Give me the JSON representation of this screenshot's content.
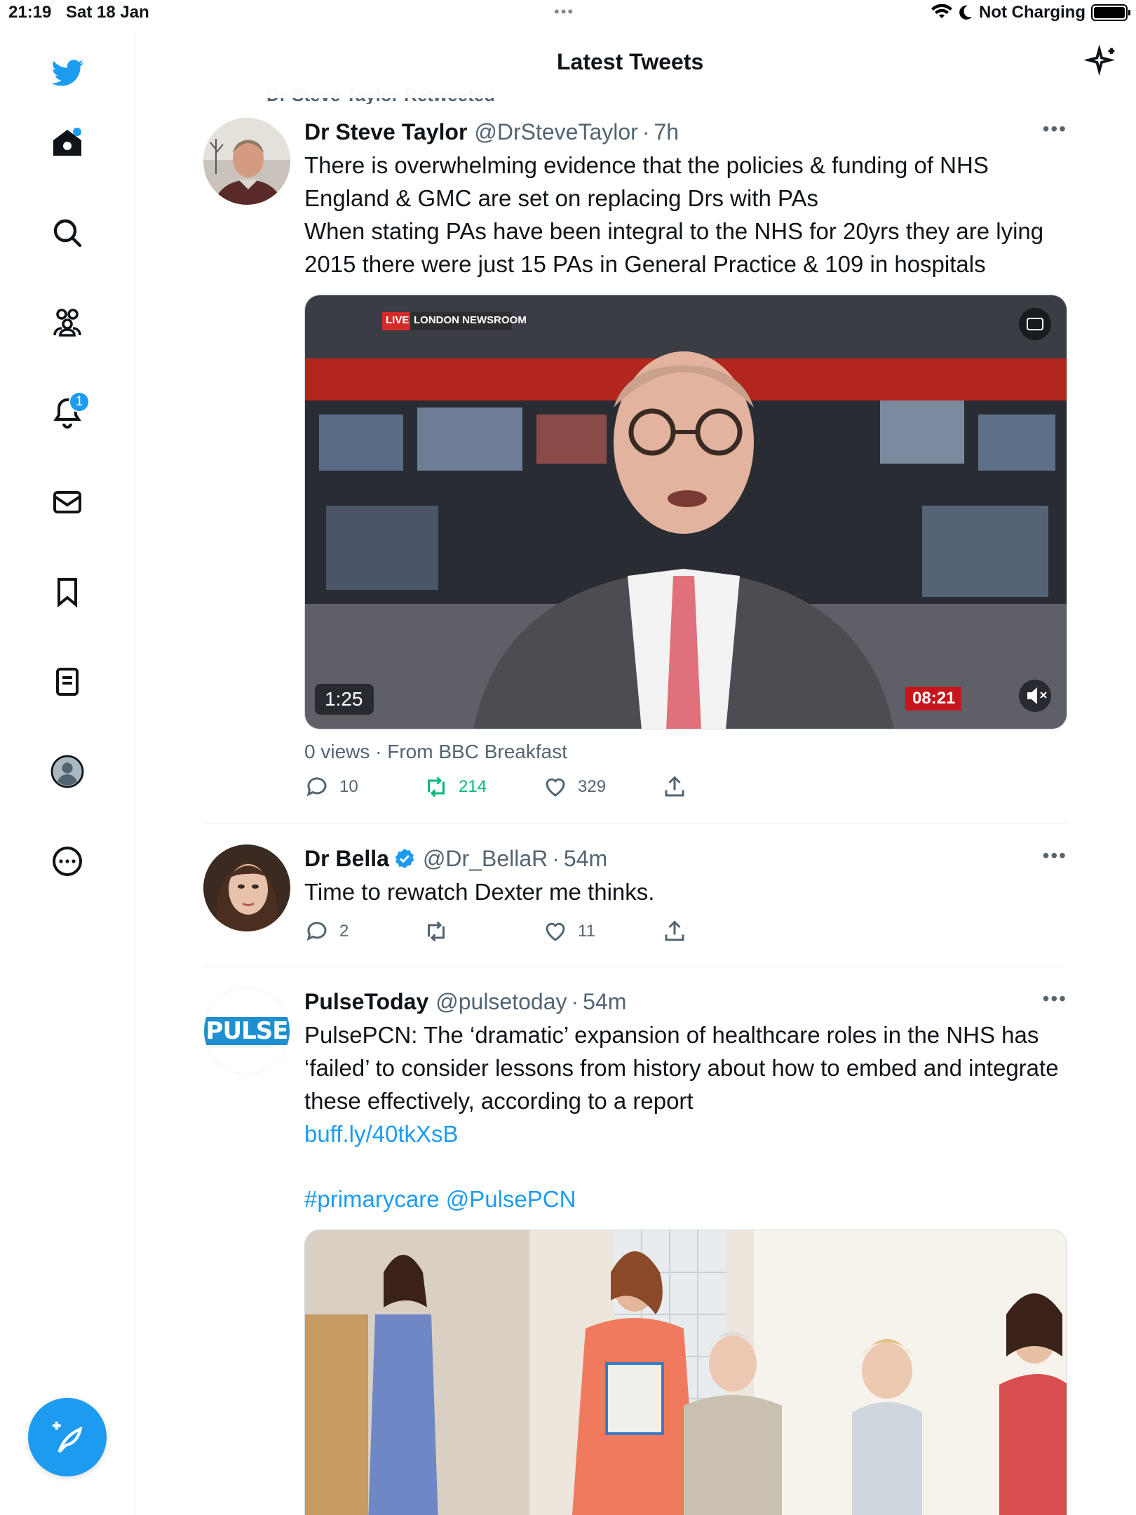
{
  "status_bar": {
    "time": "21:19",
    "date": "Sat 18 Jan",
    "dots": "•••",
    "charging": "Not Charging"
  },
  "header": {
    "title": "Latest Tweets"
  },
  "sidebar": {
    "items": [
      {
        "icon": "twitter-logo-icon"
      },
      {
        "icon": "home-icon",
        "has_dot": true
      },
      {
        "icon": "search-icon"
      },
      {
        "icon": "communities-icon"
      },
      {
        "icon": "bell-icon",
        "badge": "1"
      },
      {
        "icon": "mail-icon"
      },
      {
        "icon": "bookmark-icon"
      },
      {
        "icon": "lists-icon"
      },
      {
        "icon": "profile-icon"
      },
      {
        "icon": "more-icon"
      }
    ],
    "compose_icon": "compose-icon"
  },
  "colors": {
    "accent": "#1d9bf0",
    "retweet_green": "#00ba7c",
    "secondary_text": "#536471"
  },
  "retweet_context": "Dr Steve Taylor Retweeted",
  "tweets": [
    {
      "name": "Dr Steve Taylor",
      "handle": "@DrSteveTaylor",
      "time": "7h",
      "text": "There is overwhelming evidence that the policies & funding of NHS England & GMC are set on replacing Drs with PAs\nWhen stating PAs have been integral to the NHS for 20yrs they are lying\n2015 there were just 15 PAs in General Practice & 109 in hospitals",
      "video": {
        "live_label": "LIVE",
        "channel_label": "LONDON NEWSROOM",
        "duration": "1:25",
        "clock": "08:21"
      },
      "views": "0 views · From BBC Breakfast",
      "replies": "10",
      "retweets": "214",
      "likes": "329"
    },
    {
      "name": "Dr Bella",
      "handle": "@Dr_BellaR",
      "time": "54m",
      "verified": true,
      "text": "Time to rewatch Dexter me thinks.",
      "replies": "2",
      "retweets": "",
      "likes": "11"
    },
    {
      "name": "PulseToday",
      "handle": "@pulsetoday",
      "time": "54m",
      "avatar_text": "PULSE",
      "text": "PulsePCN: The ‘dramatic’ expansion of healthcare roles in the NHS has ‘failed’ to consider lessons from history about how to embed and integrate these effectively, according to a report",
      "link": "buff.ly/40tkXsB",
      "tags": "#primarycare @PulsePCN"
    }
  ]
}
